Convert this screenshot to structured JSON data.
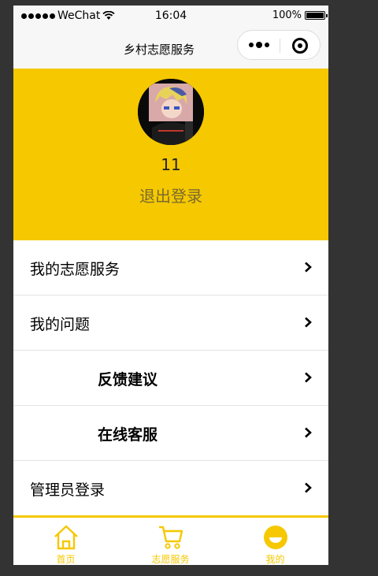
{
  "status_bar": {
    "carrier": "WeChat",
    "time": "16:04",
    "battery": "100%"
  },
  "nav": {
    "title": "乡村志愿服务"
  },
  "profile": {
    "username": "11",
    "logout_label": "退出登录"
  },
  "menu": {
    "items": [
      {
        "label": "我的志愿服务"
      },
      {
        "label": "我的问题"
      },
      {
        "label": "反馈建议"
      },
      {
        "label": "在线客服"
      },
      {
        "label": "管理员登录"
      }
    ]
  },
  "tabs": [
    {
      "label": "首页",
      "icon": "home-icon"
    },
    {
      "label": "志愿服务",
      "icon": "cart-icon"
    },
    {
      "label": "我的",
      "icon": "profile-icon"
    }
  ],
  "colors": {
    "accent": "#f5c800",
    "logout_text": "#7a6a30"
  }
}
